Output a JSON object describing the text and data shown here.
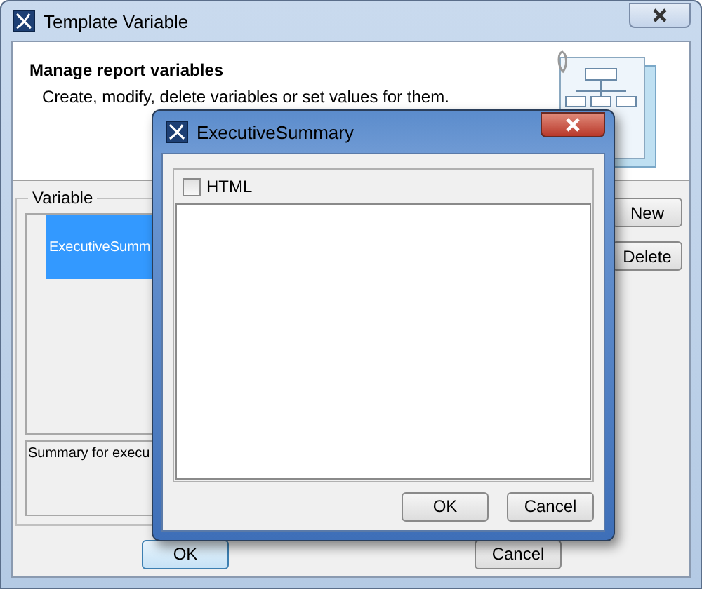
{
  "window": {
    "title": "Template Variable"
  },
  "header": {
    "title": "Manage report variables",
    "description": "Create, modify, delete variables or set values for them."
  },
  "variable_group": {
    "label": "Variable",
    "items": [
      {
        "label": "ExecutiveSumm",
        "selected": true
      }
    ],
    "description": "Summary for execu"
  },
  "side_buttons": [
    "New",
    "Delete"
  ],
  "buttons": [
    {
      "label": "OK",
      "default": true
    },
    {
      "label": "Cancel",
      "default": false
    }
  ],
  "dialog": {
    "title": "ExecutiveSummary",
    "html_checkbox": {
      "label": "HTML",
      "checked": false
    },
    "buttons": [
      "OK",
      "Cancel"
    ]
  }
}
